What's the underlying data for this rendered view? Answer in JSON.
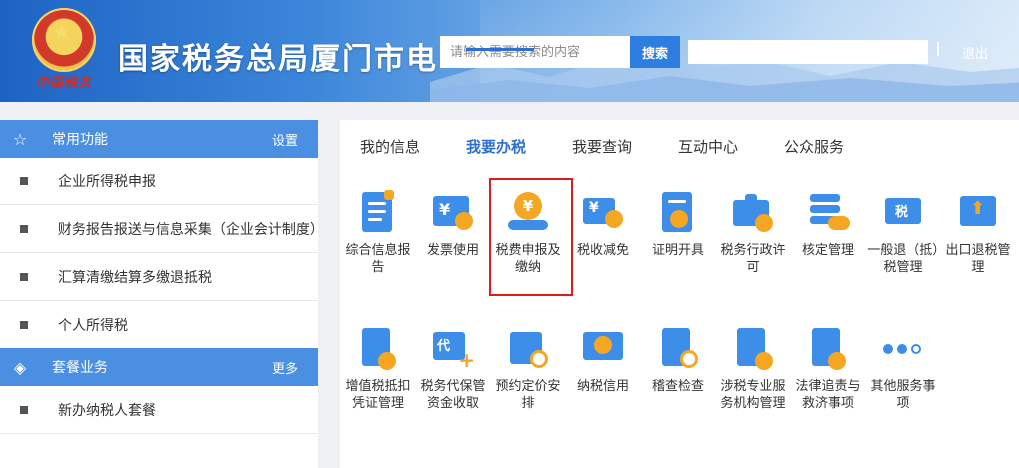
{
  "header": {
    "site_title": "国家税务总局厦门市电",
    "emblem_text": "中国税务",
    "search_placeholder": "请输入需要搜索的内容",
    "search_button": "搜索",
    "logout": "退出"
  },
  "sidebar": {
    "common": {
      "title": "常用功能",
      "link": "设置",
      "items": [
        "企业所得税申报",
        "财务报告报送与信息采集（企业会计制度）",
        "汇算清缴结算多缴退抵税",
        "个人所得税"
      ]
    },
    "package": {
      "title": "套餐业务",
      "link": "更多",
      "items": [
        "新办纳税人套餐"
      ]
    }
  },
  "tabs": [
    "我的信息",
    "我要办税",
    "我要查询",
    "互动中心",
    "公众服务"
  ],
  "active_tab": "我要办税",
  "services": [
    {
      "label": "综合信息报告",
      "icon": "report-icon"
    },
    {
      "label": "发票使用",
      "icon": "invoice-icon"
    },
    {
      "label": "税费申报及缴纳",
      "icon": "tax-payment-icon"
    },
    {
      "label": "税收减免",
      "icon": "tax-relief-icon"
    },
    {
      "label": "证明开具",
      "icon": "certificate-icon"
    },
    {
      "label": "税务行政许可",
      "icon": "license-icon"
    },
    {
      "label": "核定管理",
      "icon": "assessment-icon"
    },
    {
      "label": "一般退（抵）税管理",
      "icon": "refund-icon"
    },
    {
      "label": "出口退税管理",
      "icon": "export-refund-icon"
    },
    {
      "label": "增值税抵扣凭证管理",
      "icon": "vat-deduction-icon"
    },
    {
      "label": "税务代保管资金收取",
      "icon": "custody-fund-icon"
    },
    {
      "label": "预约定价安排",
      "icon": "pricing-arrangement-icon"
    },
    {
      "label": "纳税信用",
      "icon": "tax-credit-icon"
    },
    {
      "label": "稽查检查",
      "icon": "inspection-icon"
    },
    {
      "label": "涉税专业服务机构管理",
      "icon": "agency-management-icon"
    },
    {
      "label": "法律追责与救济事项",
      "icon": "legal-remedy-icon"
    },
    {
      "label": "其他服务事项",
      "icon": "more-services-icon"
    }
  ],
  "colors": {
    "primary": "#2e6fd0",
    "sidebar_head": "#4a8fe2",
    "highlight": "#d81e1e",
    "orange": "#f5a623"
  }
}
